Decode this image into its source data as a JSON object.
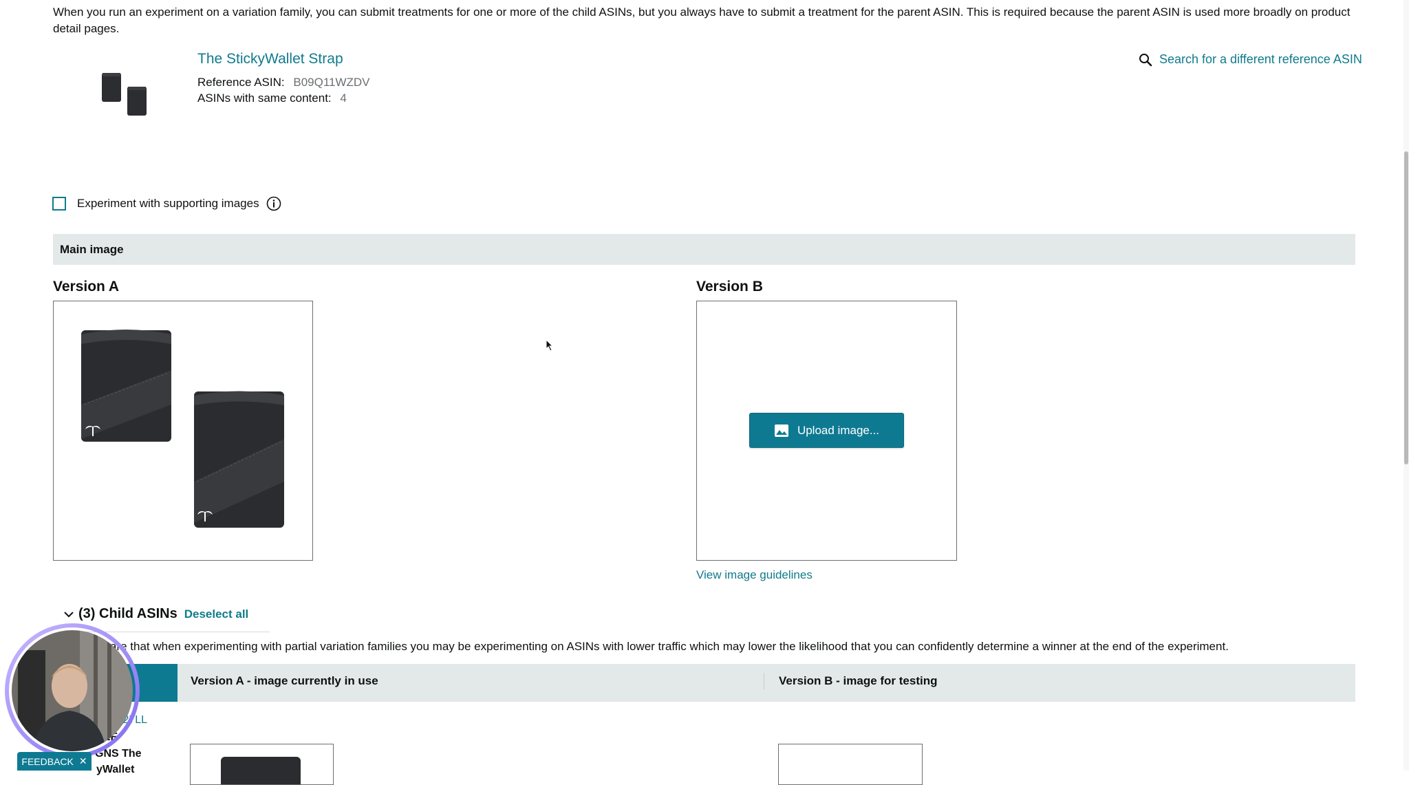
{
  "intro_text": "When you run an experiment on a variation family, you can submit treatments for one or more of the child ASINs, but you always have to submit a treatment for the parent ASIN. This is required because the parent ASIN is used more broadly on product detail pages.",
  "product": {
    "title": "The StickyWallet Strap",
    "ref_asin_label": "Reference ASIN:",
    "ref_asin_value": "B09Q11WZDV",
    "same_content_label": "ASINs with same content:",
    "same_content_value": "4"
  },
  "search_reference": {
    "label": "Search for a different reference ASIN",
    "icon": "search-icon"
  },
  "supporting_images": {
    "label": "Experiment with supporting images",
    "checked": false
  },
  "main_image_section": {
    "label": "Main image"
  },
  "version_a": {
    "label": "Version A"
  },
  "version_b": {
    "label": "Version B",
    "upload_label": "Upload image..."
  },
  "view_guidelines": "View image guidelines",
  "child_asins": {
    "title": "(3) Child ASINs",
    "deselect_all": "Deselect all",
    "note": "are that when experimenting with partial variation families you may be experimenting on ASINs with lower traffic which may lower the likelihood that you can confidently determine a winner at the end of the experiment."
  },
  "table": {
    "col_a": "Version A - image currently in use",
    "col_b": "Version B - image for testing",
    "row": {
      "asin": "3FF27LL",
      "line1": "YLE",
      "line2": "GNS The",
      "line3": "yWallet"
    }
  },
  "feedback": {
    "label": "FEEDBACK",
    "close": "✕"
  },
  "colors": {
    "accent": "#0e7a92",
    "link": "#0f7b8c",
    "section_bg": "#e3e9e9"
  }
}
